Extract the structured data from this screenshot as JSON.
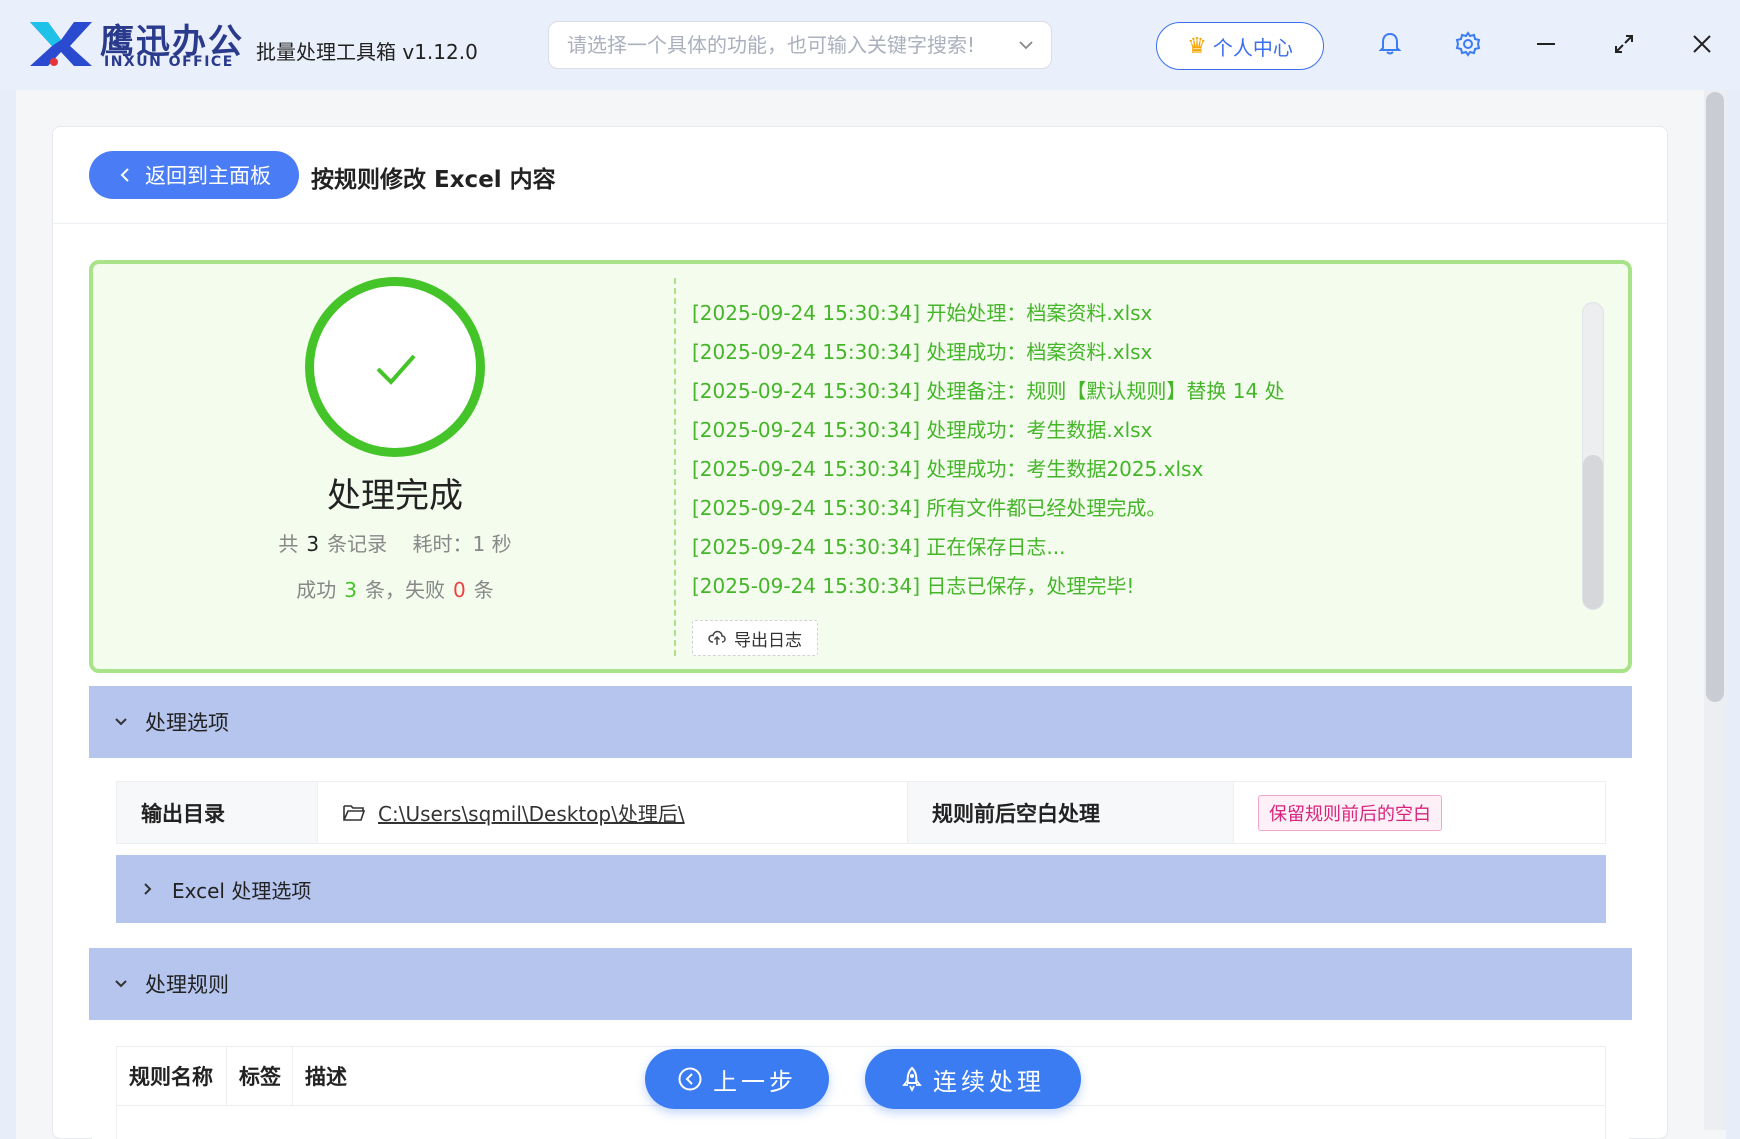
{
  "titlebar": {
    "brand_cn": "鹰迅办公",
    "brand_en": "INXUN OFFICE",
    "app_title": "批量处理工具箱 v1.12.0",
    "search_placeholder": "请选择一个具体的功能，也可输入关键字搜索!",
    "personal_center": "个人中心",
    "icons": [
      "bell-icon",
      "gear-icon",
      "minimize-icon",
      "maximize-icon",
      "close-icon"
    ]
  },
  "header": {
    "back_label": "返回到主面板",
    "page_title": "按规则修改 Excel 内容"
  },
  "result": {
    "title": "处理完成",
    "total_prefix": "共",
    "total_count": "3",
    "total_suffix": "条记录",
    "time_label": "耗时：1 秒",
    "success_prefix": "成功",
    "success_count": "3",
    "success_suffix": "条，失败",
    "fail_count": "0",
    "fail_suffix": "条",
    "logs": [
      "[2025-09-24 15:30:34] 开始处理：档案资料.xlsx",
      "[2025-09-24 15:30:34] 处理成功：档案资料.xlsx",
      "[2025-09-24 15:30:34] 处理备注：规则【默认规则】替换 14 处",
      "[2025-09-24 15:30:34] 处理成功：考生数据.xlsx",
      "[2025-09-24 15:30:34] 处理成功：考生数据2025.xlsx",
      "[2025-09-24 15:30:34] 所有文件都已经处理完成。",
      "[2025-09-24 15:30:34] 正在保存日志...",
      "[2025-09-24 15:30:34] 日志已保存，处理完毕!"
    ],
    "export_label": "导出日志"
  },
  "options": {
    "section_label": "处理选项",
    "output_dir_label": "输出目录",
    "output_dir_value": "C:\\Users\\sqmil\\Desktop\\处理后\\",
    "whitespace_label": "规则前后空白处理",
    "whitespace_value": "保留规则前后的空白",
    "excel_options_label": "Excel 处理选项"
  },
  "rules": {
    "section_label": "处理规则",
    "columns": [
      "规则名称",
      "标签",
      "描述"
    ]
  },
  "footer": {
    "prev_label": "上一步",
    "continue_label": "连续处理"
  },
  "colors": {
    "accent": "#3b7cf2",
    "success": "#45c42a",
    "fail": "#f04040",
    "section_bg": "#b6c5ee"
  }
}
